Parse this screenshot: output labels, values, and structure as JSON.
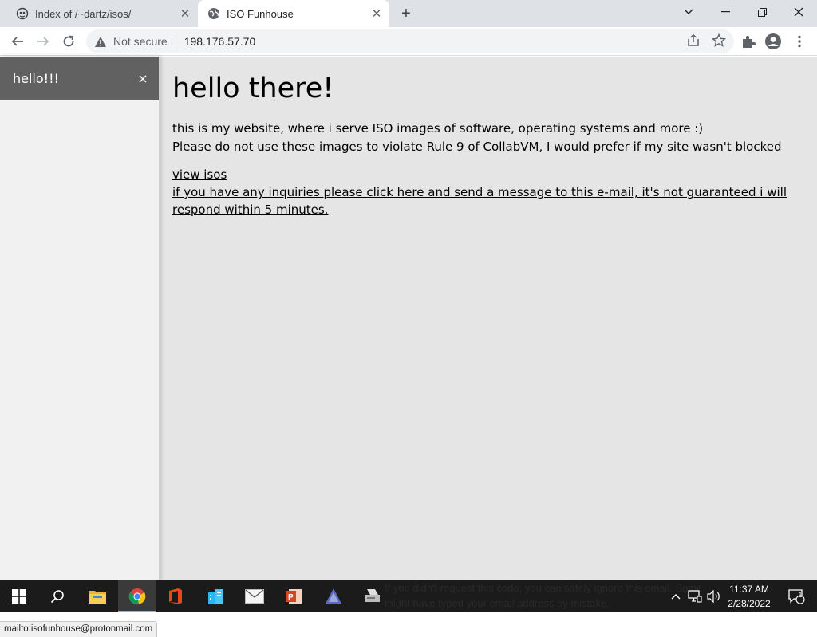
{
  "browser": {
    "tabs": [
      {
        "title": "Index of /~dartz/isos/",
        "active": false
      },
      {
        "title": "ISO Funhouse",
        "active": true
      }
    ],
    "security_label": "Not secure",
    "url": "198.176.57.70"
  },
  "sidebar": {
    "title": "hello!!!",
    "close_label": "×"
  },
  "page": {
    "heading": "hello there!",
    "intro_line1": "this is my website, where i serve ISO images of software, operating systems and more :)",
    "intro_line2": "Please do not use these images to violate Rule 9 of CollabVM, I would prefer if my site wasn't blocked",
    "link_view_isos": "view isos",
    "link_contact": "if you have any inquiries please click here and send a message to this e-mail, it's not guaranteed i will respond within 5 minutes."
  },
  "statusbar": {
    "text": "mailto:isofunhouse@protonmail.com"
  },
  "taskbar": {
    "bleed_line1": "If you didn't request this code, you can safely ignore this email. Some",
    "bleed_line2": "might have typed your email address by mistake.",
    "time": "11:37 AM",
    "date": "2/28/2022",
    "notification_count": "1"
  },
  "colors": {
    "tabstrip": "#dee1e6",
    "page_bg": "#e5e5e5",
    "sidebar_header": "#616161",
    "taskbar": "#1b1b1b"
  }
}
